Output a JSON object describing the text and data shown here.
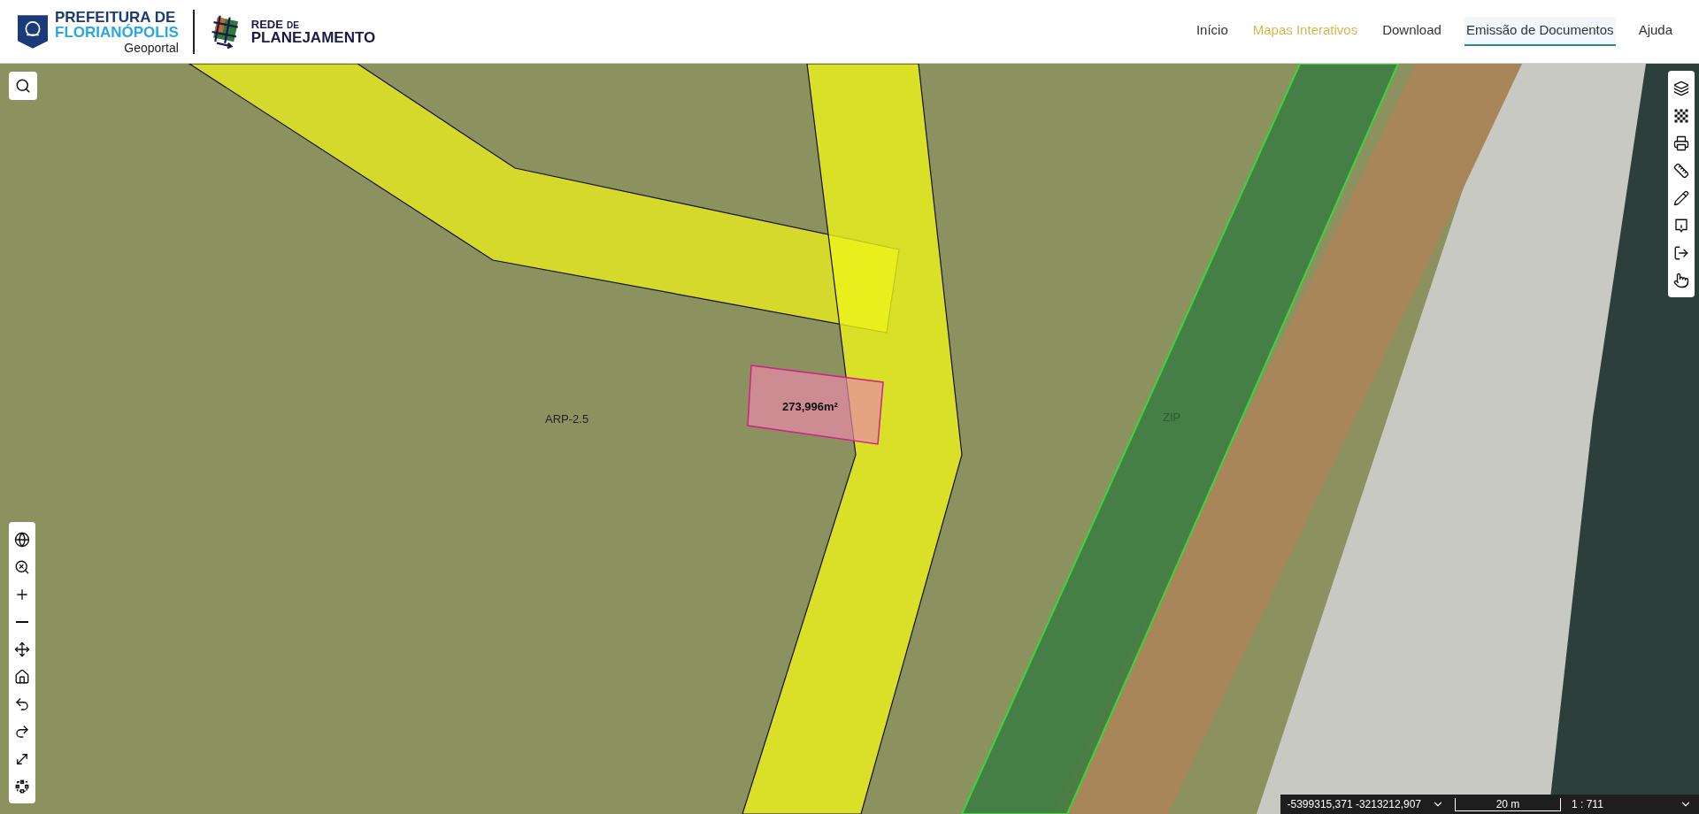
{
  "header": {
    "brand": {
      "line1": "PREFEITURA DE",
      "line2": "FLORIANÓPOLIS",
      "subtitle": "Geoportal"
    },
    "partner": {
      "word1": "REDE",
      "word2": "DE",
      "word3": "PLANEJAMENTO"
    }
  },
  "nav": [
    {
      "label": "Início",
      "selected": false,
      "highlighted": false
    },
    {
      "label": "Mapas Interativos",
      "selected": false,
      "highlighted": true
    },
    {
      "label": "Download",
      "selected": false,
      "highlighted": false
    },
    {
      "label": "Emissão de Documentos",
      "selected": true,
      "highlighted": false
    },
    {
      "label": "Ajuda",
      "selected": false,
      "highlighted": false
    }
  ],
  "map": {
    "labels": [
      {
        "kind": "zone",
        "text": "ARP-2.5"
      },
      {
        "kind": "area",
        "text": "273,996m²"
      },
      {
        "kind": "zone2",
        "text": "ZIP"
      }
    ]
  },
  "status_bar": {
    "coordinates": "-5399315,371 -3213212,907",
    "scale_bar": "20 m",
    "scale": "1 : 711"
  }
}
